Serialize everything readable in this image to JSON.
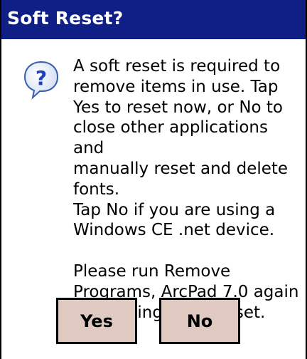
{
  "dialog": {
    "title": "Soft Reset?",
    "icon": "question-icon",
    "message": "A soft reset is required to\nremove items in use. Tap\nYes to reset now, or No to\nclose other applications and\nmanually reset and delete\nfonts.\nTap No if you are using a\nWindows CE .net device.\n\nPlease run Remove\nPrograms, ArcPad 7.0 again\nafter doing a soft reset.",
    "buttons": {
      "yes_label": "Yes",
      "no_label": "No"
    }
  },
  "colors": {
    "titlebar": "#0f1f85",
    "button_face": "#dfc9c0",
    "icon_fill": "#dbe8fb",
    "icon_glyph": "#1e40b8"
  }
}
